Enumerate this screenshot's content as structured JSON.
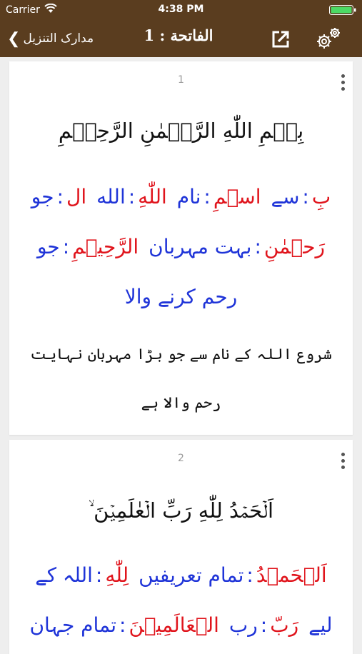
{
  "status_bar": {
    "carrier": "Carrier",
    "time": "4:38 PM"
  },
  "nav": {
    "back_label": "مدارک التنزیل",
    "title": "الفاتحة : 1"
  },
  "verses": [
    {
      "number": "1",
      "arabic": "بِسۡمِ اللّٰهِ الرَّحۡمٰنِ الرَّحِيۡمِ",
      "wbw_lines": [
        [
          {
            "ar": "بِ",
            "ur": "سے"
          },
          {
            "ar": "اسۡمِ",
            "ur": "نام"
          },
          {
            "ar": "اللّٰهِ",
            "ur": "الله"
          },
          {
            "ar": "ال",
            "ur": "جو"
          }
        ],
        [
          {
            "ar": "رَحۡمٰنِ",
            "ur": "بہت مہربان"
          },
          {
            "ar": "الرَّحِيۡمِ",
            "ur": "جو"
          }
        ],
        [
          {
            "ar": "",
            "ur": "رحم کرنے والا"
          }
        ]
      ],
      "translation": "شروع اللہ کے نام سے جو بڑا مہربان نہایت رحم والا ہے"
    },
    {
      "number": "2",
      "arabic": "اَلۡحَمۡدُ لِلّٰهِ رَبِّ الۡعٰلَمِيۡنَ ۙ",
      "wbw_lines": [
        [
          {
            "ar": "اَلۡحَمۡدُ",
            "ur": "تمام تعریفیں"
          },
          {
            "ar": "لِلّٰهِ",
            "ur": "اللہ کے"
          }
        ],
        [
          {
            "ar": "",
            "ur": "لیے"
          },
          {
            "ar": "رَبّ",
            "ur": "رب"
          },
          {
            "ar": "الۡعَالَمِيۡنَ",
            "ur": "تمام جہان"
          }
        ]
      ]
    }
  ],
  "colors": {
    "nav_bg": "#5a3d1f",
    "arabic_word": "#e0141c",
    "urdu_meaning": "#1f34d8",
    "page_bg": "#eeeeee"
  },
  "icons": {
    "back": "chevron-left-icon",
    "share": "share-icon",
    "settings": "gear-icon",
    "more": "more-vertical-icon"
  }
}
